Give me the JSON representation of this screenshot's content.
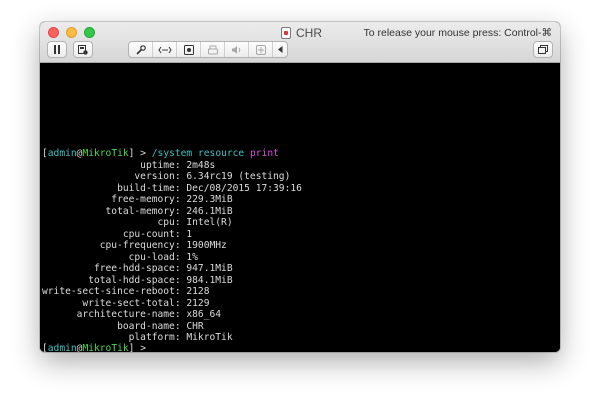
{
  "window": {
    "title": "CHR",
    "release_message": "To release your mouse press: Control-⌘"
  },
  "toolbar": {
    "pause_icon": "pause-icon",
    "snapshot_icon": "snapshot-icon",
    "buttons": [
      {
        "icon": "wrench-icon",
        "glyph": "🔧"
      },
      {
        "icon": "network-icon",
        "glyph": "‹··›"
      },
      {
        "icon": "disk-icon",
        "glyph": "▣"
      },
      {
        "icon": "printer-icon",
        "glyph": "⌂"
      },
      {
        "icon": "speaker-icon",
        "glyph": "🔈"
      },
      {
        "icon": "camera-icon",
        "glyph": "▨"
      },
      {
        "icon": "chevron-left-icon",
        "glyph": "◂"
      }
    ],
    "window_icon": "restore-window-icon"
  },
  "terminal": {
    "prompt_user": "admin",
    "prompt_at": "@",
    "prompt_host": "MikroTik",
    "prompt_suffix": "] > ",
    "prompt_open": "[",
    "command_path": "/system",
    "command_menu": "resource",
    "command_action": "print",
    "rows": [
      {
        "key": "            uptime:",
        "value": " 2m48s"
      },
      {
        "key": "           version:",
        "value": " 6.34rc19 (testing)"
      },
      {
        "key": "        build-time:",
        "value": " Dec/08/2015 17:39:16"
      },
      {
        "key": "       free-memory:",
        "value": " 229.3MiB"
      },
      {
        "key": "      total-memory:",
        "value": " 246.1MiB"
      },
      {
        "key": "               cpu:",
        "value": " Intel(R)"
      },
      {
        "key": "         cpu-count:",
        "value": " 1"
      },
      {
        "key": "     cpu-frequency:",
        "value": " 1900MHz"
      },
      {
        "key": "          cpu-load:",
        "value": " 1%"
      },
      {
        "key": "    free-hdd-space:",
        "value": " 947.1MiB"
      },
      {
        "key": "   total-hdd-space:",
        "value": " 984.1MiB"
      },
      {
        "key": "write-sect-since-reboot:",
        "value": " 2128"
      },
      {
        "key": "  write-sect-total:",
        "value": " 2129"
      },
      {
        "key": " architecture-name:",
        "value": " x86_64"
      },
      {
        "key": "        board-name:",
        "value": " CHR"
      },
      {
        "key": "          platform:",
        "value": " MikroTik"
      }
    ]
  },
  "colors": {
    "prompt_user": "#3ec0c0",
    "prompt_host": "#4fd84f",
    "command_keyword": "#d84fd8",
    "terminal_bg": "#000000"
  }
}
